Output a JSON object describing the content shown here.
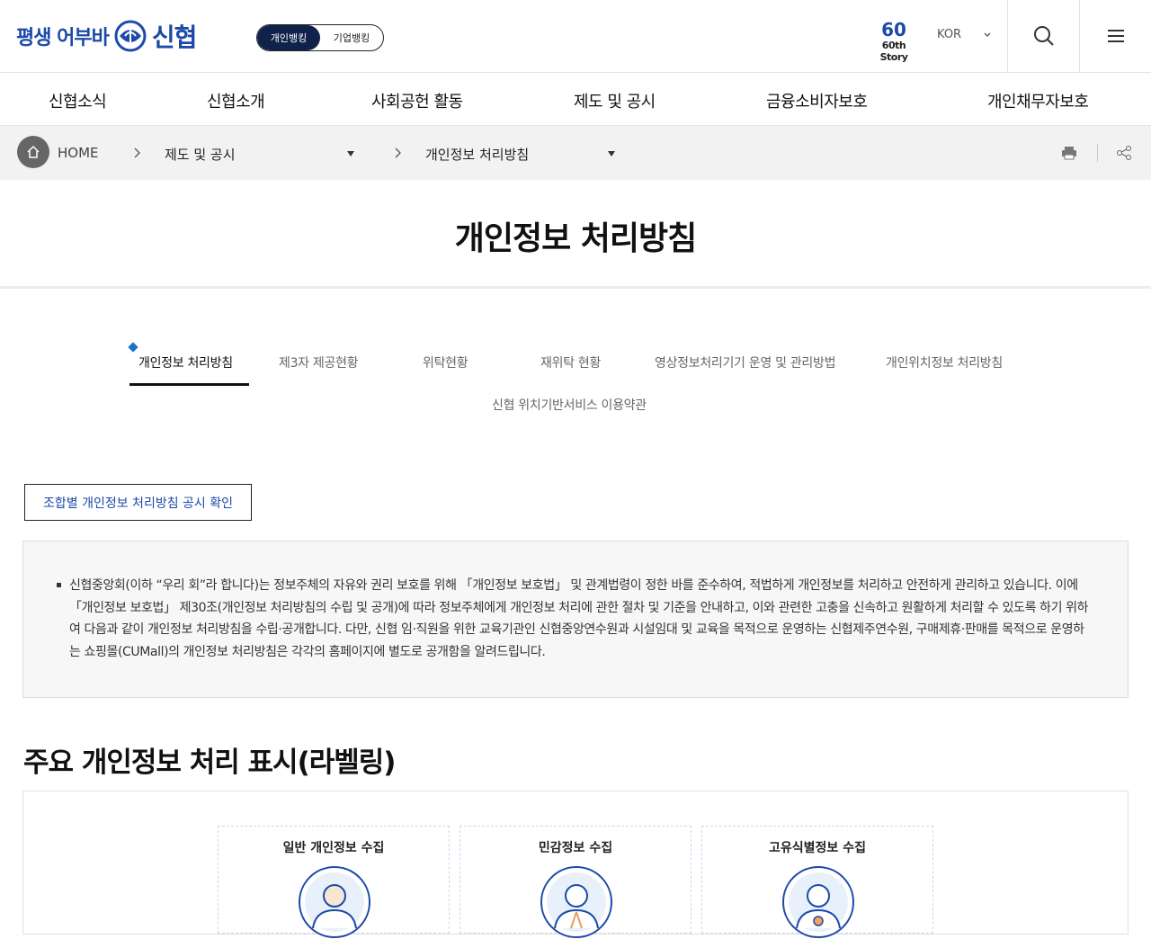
{
  "header": {
    "logo_text": "평생 어부바",
    "logo_brand": "신협",
    "bank_personal": "개인뱅킹",
    "bank_business": "기업뱅킹",
    "story_number": "60",
    "story_label": "60th Story",
    "lang": "KOR"
  },
  "gnb": [
    "신협소식",
    "신협소개",
    "사회공헌 활동",
    "제도 및 공시",
    "금융소비자보호",
    "개인채무자보호"
  ],
  "breadcrumb": {
    "home": "HOME",
    "level1": "제도 및 공시",
    "level2": "개인정보 처리방침"
  },
  "page_title": "개인정보 처리방침",
  "tabs": [
    "개인정보 처리방침",
    "제3자 제공현황",
    "위탁현황",
    "재위탁 현황",
    "영상정보처리기기 운영 및 관리방법",
    "개인위치정보 처리방침",
    "신협 위치기반서비스 이용약관"
  ],
  "notice_button": "조합별 개인정보 처리방침 공시 확인",
  "intro": "신협중앙회(이하 “우리 회”라 합니다)는 정보주체의 자유와 권리 보호를 위해 「개인정보 보호법」 및 관계법령이 정한 바를 준수하여, 적법하게 개인정보를 처리하고 안전하게 관리하고 있습니다. 이에 「개인정보 보호법」 제30조(개인정보 처리방침의 수립 및 공개)에 따라 정보주체에게 개인정보 처리에 관한 절차 및 기준을 안내하고, 이와 관련한 고충을 신속하고 원활하게 처리할 수 있도록 하기 위하여 다음과 같이 개인정보 처리방침을 수립·공개합니다. 다만, 신협 임·직원을 위한 교육기관인 신협중앙연수원과 시설임대 및 교육을 목적으로 운영하는 신협제주연수원, 구매제휴·판매를 목적으로 운영하는 쇼핑몰(CUMall)의 개인정보 처리방침은 각각의 홈페이지에 별도로 공개함을 알려드립니다.",
  "labeling": {
    "title": "주요 개인정보 처리 표시(라벨링)",
    "cards": [
      "일반 개인정보 수집",
      "민감정보 수집",
      "고유식별정보 수집"
    ]
  },
  "colors": {
    "brand": "#1c4aa8",
    "accent": "#5ab6e8",
    "toggle_dark": "#10214a"
  }
}
